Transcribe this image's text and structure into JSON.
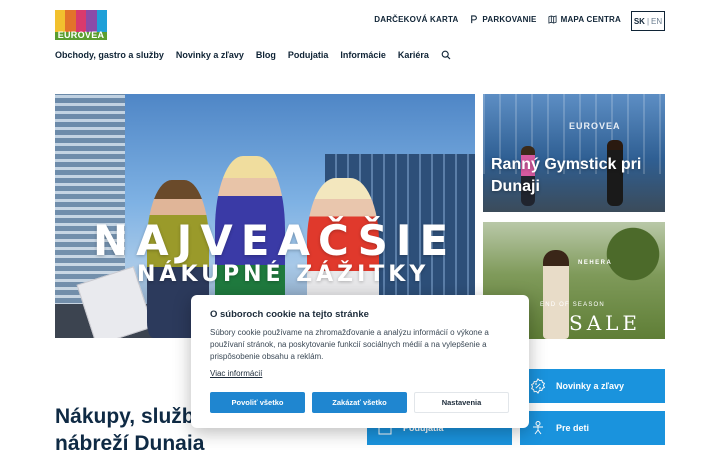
{
  "brand": {
    "logo_text": "EUROVEA",
    "stripe_colors": [
      "#f2c12e",
      "#e2742a",
      "#d83a6d",
      "#8a4ba8",
      "#1fa0d8"
    ],
    "green": "#5b9e2f"
  },
  "top_links": [
    {
      "label": "DARČEKOVÁ KARTA",
      "icon": null
    },
    {
      "label": "PARKOVANIE",
      "icon": "parking-icon"
    },
    {
      "label": "MAPA CENTRA",
      "icon": "map-icon"
    }
  ],
  "language": {
    "active": "SK",
    "separator": "|",
    "other": "EN"
  },
  "nav": {
    "items": [
      "Obchody, gastro a služby",
      "Novinky a zľavy",
      "Blog",
      "Podujatia",
      "Informácie",
      "Kariéra"
    ],
    "search_icon": "search-icon"
  },
  "hero": {
    "headline": "NAJVEAČŠIE",
    "subline": "NÁKUPNÉ ZÁŽITKY"
  },
  "cards": {
    "card1": {
      "title": "Ranný Gymstick pri Dunaji",
      "sign": "EUROVEA"
    },
    "card2": {
      "brand": "NEHERA",
      "season": "END OF SEASON",
      "sale": "SALE"
    }
  },
  "bottom": {
    "title": "Nákupy, služby a zábava na nábreží Dunaja",
    "quick_links": [
      {
        "label": "Novinky a zľavy",
        "icon": "percent-badge-icon"
      },
      {
        "label": "Pre deti",
        "icon": "child-icon"
      },
      {
        "label": "Podujatia",
        "icon": "calendar-icon"
      }
    ]
  },
  "cookie": {
    "title": "O súboroch cookie na tejto stránke",
    "text": "Súbory cookie používame na zhromažďovanie a analýzu informácií o výkone a používaní stránok, na poskytovanie funkcií sociálnych médií a na vylepšenie a prispôsobenie obsahu a reklám.",
    "more_link": "Viac informácií",
    "buttons": {
      "allow_all": "Povoliť všetko",
      "deny_all": "Zakázať všetko",
      "settings": "Nastavenia"
    }
  },
  "colors": {
    "primary_blue": "#1a93dd",
    "navy": "#102436"
  }
}
